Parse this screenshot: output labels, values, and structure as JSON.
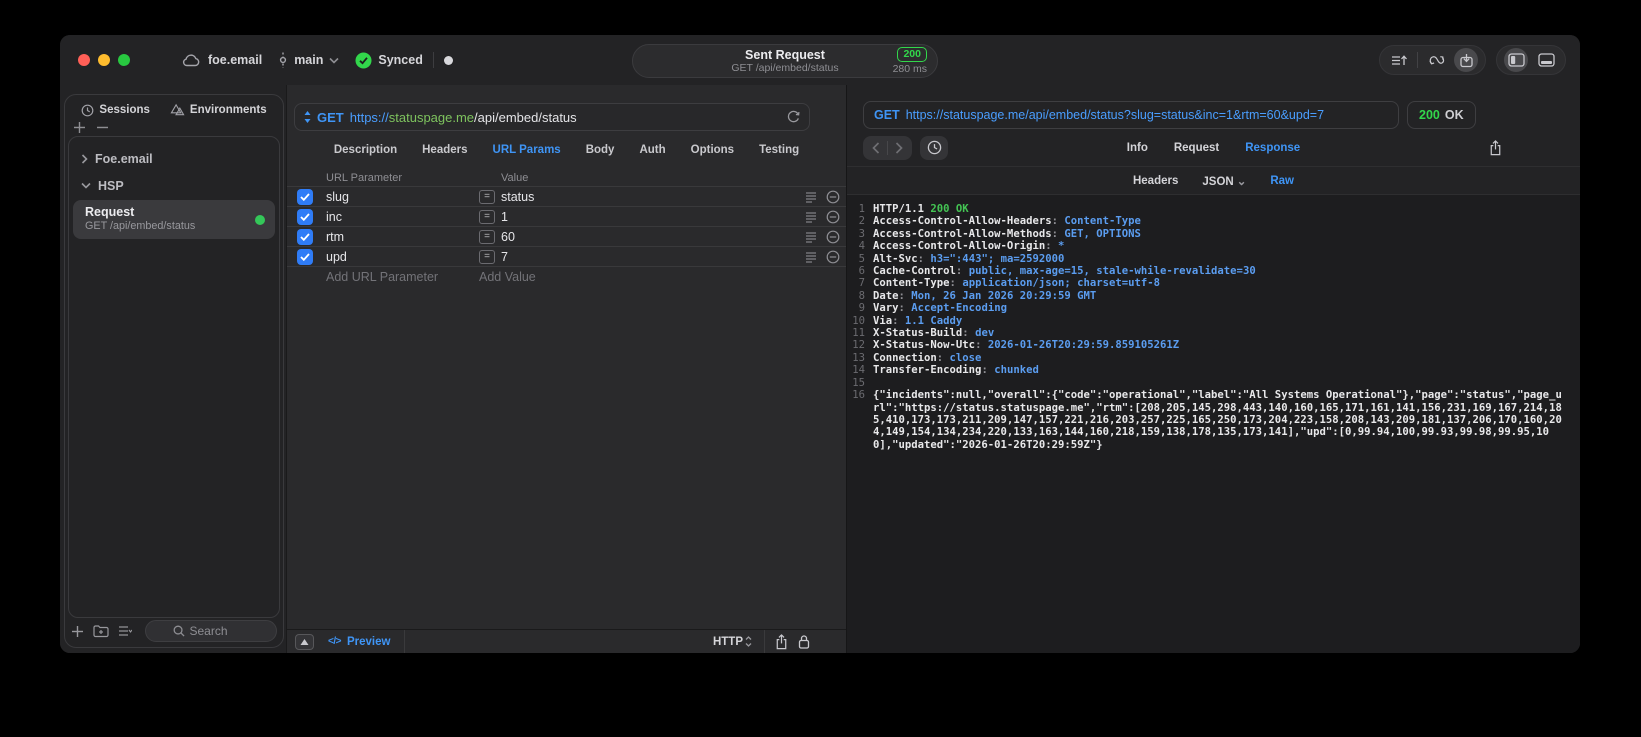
{
  "titlebar": {
    "project": "foe.email",
    "branch": "main",
    "sync_label": "Synced",
    "request_summary": {
      "title": "Sent Request",
      "method_path": "GET /api/embed/status",
      "status_code": "200",
      "duration": "280 ms"
    }
  },
  "sidebar": {
    "tabs": [
      {
        "label": "Sessions"
      },
      {
        "label": "Environments"
      }
    ],
    "tree": [
      {
        "label": "Foe.email"
      },
      {
        "label": "HSP"
      }
    ],
    "request_item": {
      "title": "Request",
      "subtitle": "GET /api/embed/status"
    },
    "search_placeholder": "Search"
  },
  "request_pane": {
    "method": "GET",
    "url": {
      "scheme": "https://",
      "host": "statuspage.me",
      "path": "/api/embed/status"
    },
    "tabs": [
      {
        "label": "Description"
      },
      {
        "label": "Headers"
      },
      {
        "label": "URL Params",
        "cls": "active"
      },
      {
        "label": "Body"
      },
      {
        "label": "Auth"
      },
      {
        "label": "Options"
      },
      {
        "label": "Testing"
      }
    ],
    "table": {
      "param_header": "URL Parameter",
      "value_header": "Value",
      "rows": [
        {
          "name": "slug",
          "value": "status",
          "eq": "="
        },
        {
          "name": "inc",
          "value": "1",
          "eq": "="
        },
        {
          "name": "rtm",
          "value": "60",
          "eq": "="
        },
        {
          "name": "upd",
          "value": "7",
          "eq": "="
        }
      ],
      "add_param_placeholder": "Add URL Parameter",
      "add_value_placeholder": "Add Value"
    },
    "footer": {
      "code_glyph": "</>",
      "preview_label": "Preview",
      "protocol": "HTTP"
    }
  },
  "response_pane": {
    "request_line": {
      "method": "GET",
      "url": "https://statuspage.me/api/embed/status?slug=status&inc=1&rtm=60&upd=7"
    },
    "status_badge": {
      "code": "200",
      "text": "OK"
    },
    "tabs": [
      {
        "label": "Info"
      },
      {
        "label": "Request"
      },
      {
        "label": "Response",
        "cls": "active"
      }
    ],
    "subtabs": [
      {
        "label": "Headers"
      },
      {
        "label": "JSON",
        "cls": "dropdown"
      },
      {
        "label": "Raw",
        "cls": "active"
      }
    ],
    "code": {
      "header_lines": [
        {
          "num": "1",
          "key": "HTTP/1.1",
          "sep": " ",
          "val": "200 OK",
          "cls": "status"
        },
        {
          "num": "2",
          "key": "Access-Control-Allow-Headers",
          "sep": ": ",
          "val": "Content-Type"
        },
        {
          "num": "3",
          "key": "Access-Control-Allow-Methods",
          "sep": ": ",
          "val": "GET, OPTIONS"
        },
        {
          "num": "4",
          "key": "Access-Control-Allow-Origin",
          "sep": ": ",
          "val": "*"
        },
        {
          "num": "5",
          "key": "Alt-Svc",
          "sep": ": ",
          "val": "h3=\":443\"; ma=2592000"
        },
        {
          "num": "6",
          "key": "Cache-Control",
          "sep": ": ",
          "val": "public, max-age=15, stale-while-revalidate=30"
        },
        {
          "num": "7",
          "key": "Content-Type",
          "sep": ": ",
          "val": "application/json; charset=utf-8"
        },
        {
          "num": "8",
          "key": "Date",
          "sep": ": ",
          "val": "Mon, 26 Jan 2026 20:29:59 GMT"
        },
        {
          "num": "9",
          "key": "Vary",
          "sep": ": ",
          "val": "Accept-Encoding"
        },
        {
          "num": "10",
          "key": "Via",
          "sep": ": ",
          "val": "1.1 Caddy"
        },
        {
          "num": "11",
          "key": "X-Status-Build",
          "sep": ": ",
          "val": "dev"
        },
        {
          "num": "12",
          "key": "X-Status-Now-Utc",
          "sep": ": ",
          "val": "2026-01-26T20:29:59.859105261Z"
        },
        {
          "num": "13",
          "key": "Connection",
          "sep": ": ",
          "val": "close"
        },
        {
          "num": "14",
          "key": "Transfer-Encoding",
          "sep": ": ",
          "val": "chunked"
        },
        {
          "num": "15",
          "key": "",
          "sep": "",
          "val": ""
        }
      ],
      "body": {
        "num": "16",
        "text": "{\"incidents\":null,\"overall\":{\"code\":\"operational\",\"label\":\"All Systems Operational\"},\"page\":\"status\",\"page_url\":\"https://status.statuspage.me\",\"rtm\":[208,205,145,298,443,140,160,165,171,161,141,156,231,169,167,214,185,410,173,173,211,209,147,157,221,216,203,257,225,165,250,173,204,223,158,208,143,209,181,137,206,170,160,204,149,154,134,234,220,133,163,144,160,218,159,138,178,135,173,141],\"upd\":[0,99.94,100,99.93,99.98,99.95,100],\"updated\":\"2026-01-26T20:29:59Z\"}"
      }
    }
  },
  "colors": {
    "accent_blue": "#3f95f6",
    "success_green": "#32d74b",
    "value_blue": "#5b9df0",
    "host_green": "#7ec35e"
  }
}
